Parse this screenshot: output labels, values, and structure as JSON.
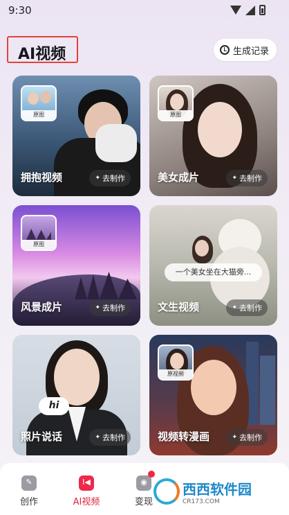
{
  "status_bar": {
    "time": "9:30"
  },
  "header": {
    "title": "AI视频",
    "history_label": "生成记录"
  },
  "cards": [
    {
      "label": "拥抱视频",
      "button": "去制作",
      "thumb_tag": "原图"
    },
    {
      "label": "美女成片",
      "button": "去制作",
      "thumb_tag": "原图"
    },
    {
      "label": "风景成片",
      "button": "去制作",
      "thumb_tag": "原图"
    },
    {
      "label": "文生视频",
      "button": "去制作",
      "prompt": "一个美女坐在大猫旁..."
    },
    {
      "label": "照片说话",
      "button": "去制作",
      "bubble": "hi"
    },
    {
      "label": "视频转漫画",
      "button": "去制作",
      "thumb_tag": "原视频"
    }
  ],
  "nav": {
    "items": [
      {
        "label": "创作",
        "icon": "create-icon"
      },
      {
        "label": "AI视频",
        "icon": "ai-video-icon",
        "active": true
      },
      {
        "label": "变现",
        "icon": "monetize-icon"
      }
    ]
  },
  "watermark": {
    "brand": "西西软件园",
    "domain": "CR173.COM"
  },
  "colors": {
    "accent": "#f0294a",
    "title_frame": "#e0433b"
  }
}
